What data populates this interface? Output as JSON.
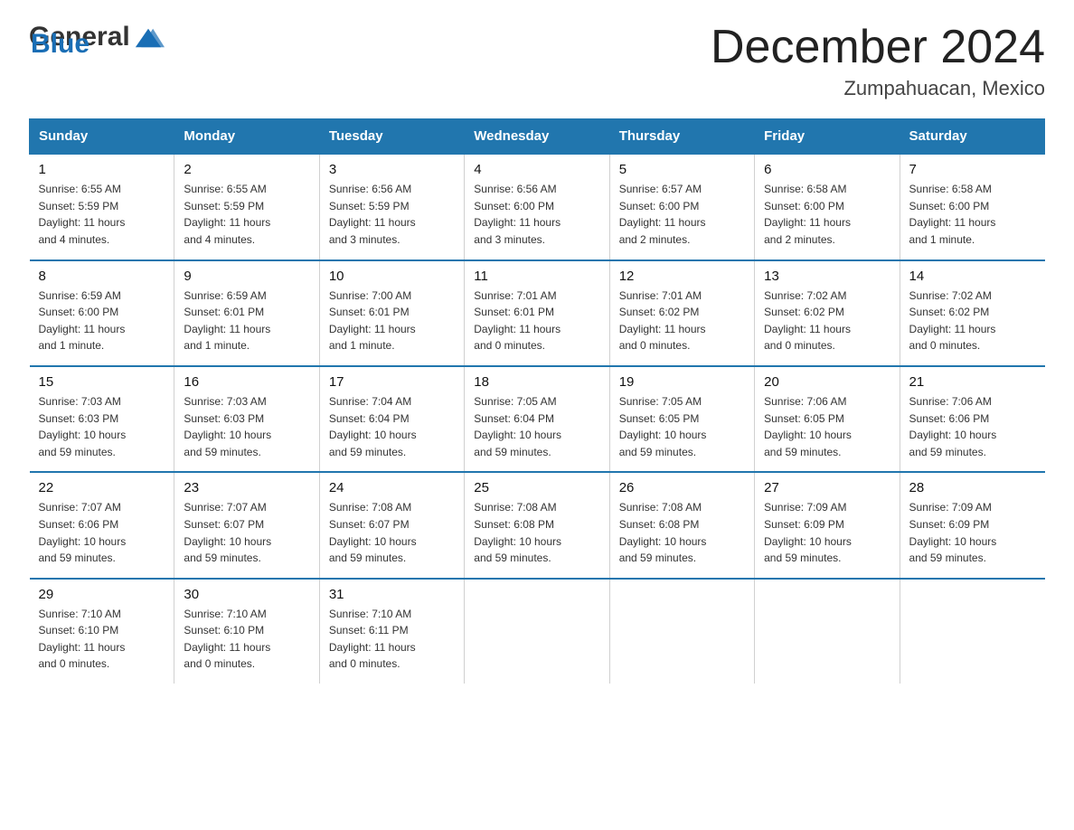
{
  "logo": {
    "text_general": "General",
    "text_blue": "Blue"
  },
  "title": {
    "month_year": "December 2024",
    "location": "Zumpahuacan, Mexico"
  },
  "days_of_week": [
    "Sunday",
    "Monday",
    "Tuesday",
    "Wednesday",
    "Thursday",
    "Friday",
    "Saturday"
  ],
  "weeks": [
    [
      {
        "day": "1",
        "sunrise": "6:55 AM",
        "sunset": "5:59 PM",
        "daylight": "11 hours and 4 minutes."
      },
      {
        "day": "2",
        "sunrise": "6:55 AM",
        "sunset": "5:59 PM",
        "daylight": "11 hours and 4 minutes."
      },
      {
        "day": "3",
        "sunrise": "6:56 AM",
        "sunset": "5:59 PM",
        "daylight": "11 hours and 3 minutes."
      },
      {
        "day": "4",
        "sunrise": "6:56 AM",
        "sunset": "6:00 PM",
        "daylight": "11 hours and 3 minutes."
      },
      {
        "day": "5",
        "sunrise": "6:57 AM",
        "sunset": "6:00 PM",
        "daylight": "11 hours and 2 minutes."
      },
      {
        "day": "6",
        "sunrise": "6:58 AM",
        "sunset": "6:00 PM",
        "daylight": "11 hours and 2 minutes."
      },
      {
        "day": "7",
        "sunrise": "6:58 AM",
        "sunset": "6:00 PM",
        "daylight": "11 hours and 1 minute."
      }
    ],
    [
      {
        "day": "8",
        "sunrise": "6:59 AM",
        "sunset": "6:00 PM",
        "daylight": "11 hours and 1 minute."
      },
      {
        "day": "9",
        "sunrise": "6:59 AM",
        "sunset": "6:01 PM",
        "daylight": "11 hours and 1 minute."
      },
      {
        "day": "10",
        "sunrise": "7:00 AM",
        "sunset": "6:01 PM",
        "daylight": "11 hours and 1 minute."
      },
      {
        "day": "11",
        "sunrise": "7:01 AM",
        "sunset": "6:01 PM",
        "daylight": "11 hours and 0 minutes."
      },
      {
        "day": "12",
        "sunrise": "7:01 AM",
        "sunset": "6:02 PM",
        "daylight": "11 hours and 0 minutes."
      },
      {
        "day": "13",
        "sunrise": "7:02 AM",
        "sunset": "6:02 PM",
        "daylight": "11 hours and 0 minutes."
      },
      {
        "day": "14",
        "sunrise": "7:02 AM",
        "sunset": "6:02 PM",
        "daylight": "11 hours and 0 minutes."
      }
    ],
    [
      {
        "day": "15",
        "sunrise": "7:03 AM",
        "sunset": "6:03 PM",
        "daylight": "10 hours and 59 minutes."
      },
      {
        "day": "16",
        "sunrise": "7:03 AM",
        "sunset": "6:03 PM",
        "daylight": "10 hours and 59 minutes."
      },
      {
        "day": "17",
        "sunrise": "7:04 AM",
        "sunset": "6:04 PM",
        "daylight": "10 hours and 59 minutes."
      },
      {
        "day": "18",
        "sunrise": "7:05 AM",
        "sunset": "6:04 PM",
        "daylight": "10 hours and 59 minutes."
      },
      {
        "day": "19",
        "sunrise": "7:05 AM",
        "sunset": "6:05 PM",
        "daylight": "10 hours and 59 minutes."
      },
      {
        "day": "20",
        "sunrise": "7:06 AM",
        "sunset": "6:05 PM",
        "daylight": "10 hours and 59 minutes."
      },
      {
        "day": "21",
        "sunrise": "7:06 AM",
        "sunset": "6:06 PM",
        "daylight": "10 hours and 59 minutes."
      }
    ],
    [
      {
        "day": "22",
        "sunrise": "7:07 AM",
        "sunset": "6:06 PM",
        "daylight": "10 hours and 59 minutes."
      },
      {
        "day": "23",
        "sunrise": "7:07 AM",
        "sunset": "6:07 PM",
        "daylight": "10 hours and 59 minutes."
      },
      {
        "day": "24",
        "sunrise": "7:08 AM",
        "sunset": "6:07 PM",
        "daylight": "10 hours and 59 minutes."
      },
      {
        "day": "25",
        "sunrise": "7:08 AM",
        "sunset": "6:08 PM",
        "daylight": "10 hours and 59 minutes."
      },
      {
        "day": "26",
        "sunrise": "7:08 AM",
        "sunset": "6:08 PM",
        "daylight": "10 hours and 59 minutes."
      },
      {
        "day": "27",
        "sunrise": "7:09 AM",
        "sunset": "6:09 PM",
        "daylight": "10 hours and 59 minutes."
      },
      {
        "day": "28",
        "sunrise": "7:09 AM",
        "sunset": "6:09 PM",
        "daylight": "10 hours and 59 minutes."
      }
    ],
    [
      {
        "day": "29",
        "sunrise": "7:10 AM",
        "sunset": "6:10 PM",
        "daylight": "11 hours and 0 minutes."
      },
      {
        "day": "30",
        "sunrise": "7:10 AM",
        "sunset": "6:10 PM",
        "daylight": "11 hours and 0 minutes."
      },
      {
        "day": "31",
        "sunrise": "7:10 AM",
        "sunset": "6:11 PM",
        "daylight": "11 hours and 0 minutes."
      },
      null,
      null,
      null,
      null
    ]
  ],
  "labels": {
    "sunrise": "Sunrise:",
    "sunset": "Sunset:",
    "daylight": "Daylight:"
  }
}
